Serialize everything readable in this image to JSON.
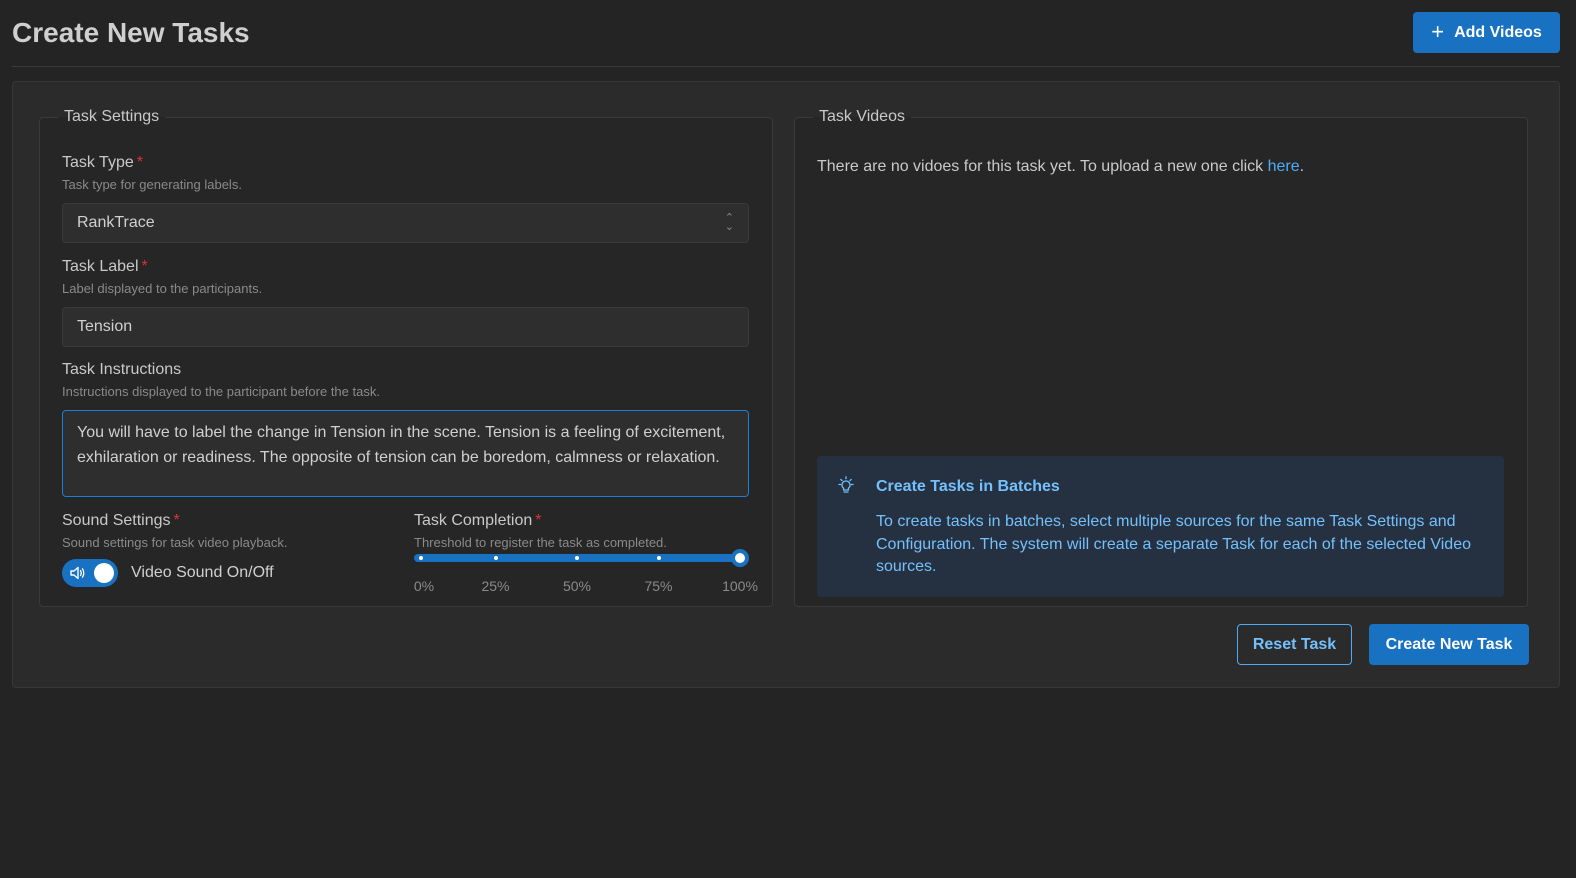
{
  "header": {
    "title": "Create New Tasks",
    "add_videos_label": "Add Videos",
    "add_videos_icon": "plus-icon"
  },
  "task_settings": {
    "legend": "Task Settings",
    "task_type": {
      "label": "Task Type",
      "required": "*",
      "description": "Task type for generating labels.",
      "value": "RankTrace"
    },
    "task_label": {
      "label": "Task Label",
      "required": "*",
      "description": "Label displayed to the participants.",
      "value": "Tension"
    },
    "task_instructions": {
      "label": "Task Instructions",
      "description": "Instructions displayed to the participant before the task.",
      "value": "You will have to label the change in Tension in the scene. Tension is a feeling of excitement, exhilaration or readiness. The opposite of tension can be boredom, calmness or relaxation."
    },
    "sound_settings": {
      "label": "Sound Settings",
      "required": "*",
      "description": "Sound settings for task video playback.",
      "toggle_label": "Video Sound On/Off",
      "toggle_on": true,
      "toggle_icon": "speaker-icon"
    },
    "task_completion": {
      "label": "Task Completion",
      "required": "*",
      "description": "Threshold to register the task as completed.",
      "value_percent": 100,
      "marks": [
        "0%",
        "25%",
        "50%",
        "75%",
        "100%"
      ]
    }
  },
  "task_videos": {
    "legend": "Task Videos",
    "empty_text": "There are no vidoes for this task yet. To upload a new one click ",
    "link_text": "here",
    "link_suffix": ".",
    "alert": {
      "icon": "bulb-icon",
      "title": "Create Tasks in Batches",
      "body": "To create tasks in batches, select multiple sources for the same Task Settings and Configuration. The system will create a separate Task for each of the selected Video sources."
    }
  },
  "actions": {
    "reset_label": "Reset Task",
    "create_label": "Create New Task"
  },
  "colors": {
    "accent": "#1971c2",
    "info_text": "#74c0fc",
    "required": "#e03131",
    "background": "#242424"
  }
}
